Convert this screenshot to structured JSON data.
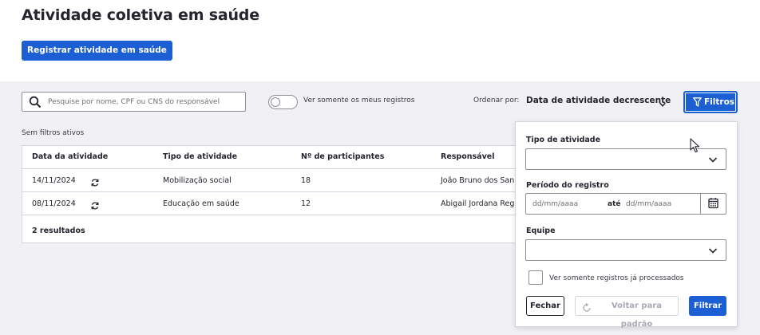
{
  "page_title": "Atividade coletiva em saúde",
  "register_button": "Registrar atividade em saúde",
  "search": {
    "placeholder": "Pesquise por nome, CPF ou CNS do responsável",
    "value": ""
  },
  "toggle": {
    "label": "Ver somente os meus registros",
    "on": false
  },
  "sort": {
    "label": "Ordenar por:",
    "value": "Data de atividade decrescente"
  },
  "filters_button": "Filtros",
  "filters_status": "Sem filtros ativos",
  "table": {
    "columns": [
      "Data da atividade",
      "Tipo de atividade",
      "Nº de participantes",
      "Responsável"
    ],
    "rows": [
      {
        "date": "14/11/2024",
        "type": "Mobilização social",
        "participants": "18",
        "responsible": "João Bruno dos San"
      },
      {
        "date": "08/11/2024",
        "type": "Educação em saúde",
        "participants": "12",
        "responsible": "Abigail Jordana Reg"
      }
    ],
    "results": "2 resultados"
  },
  "filter_panel": {
    "activity_type_label": "Tipo de atividade",
    "activity_type_value": "",
    "period_label": "Período do registro",
    "date_from_placeholder": "dd/mm/aaaa",
    "date_separator": "até",
    "date_to_placeholder": "dd/mm/aaaa",
    "team_label": "Equipe",
    "team_value": "",
    "processed_only_label": "Ver somente registros já processados",
    "processed_only_checked": false,
    "close_button": "Fechar",
    "reset_button": "Voltar para padrão",
    "filter_button": "Filtrar"
  },
  "colors": {
    "primary": "#1c5fd4",
    "background": "#f1f1f5",
    "text": "#24252e",
    "border": "#8f8f99"
  }
}
